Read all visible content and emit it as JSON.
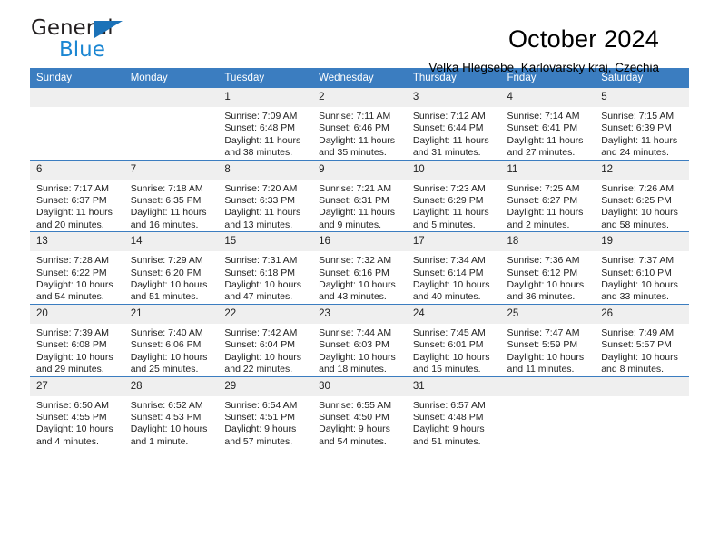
{
  "brand": {
    "name_part1": "General",
    "name_part2": "Blue",
    "triangle_icon": "triangle-icon",
    "accent_color": "#1b72b8",
    "blue_text_color": "#1b86d2"
  },
  "header": {
    "title": "October 2024",
    "subtitle": "Velka Hlegsebe, Karlovarsky kraj, Czechia"
  },
  "calendar": {
    "header_bg": "#3b7dc0",
    "daynum_bg": "#efefef",
    "weekday_headers": [
      "Sunday",
      "Monday",
      "Tuesday",
      "Wednesday",
      "Thursday",
      "Friday",
      "Saturday"
    ],
    "weeks": [
      [
        {
          "day": "",
          "sunrise": "",
          "sunset": "",
          "daylight1": "",
          "daylight2": ""
        },
        {
          "day": "",
          "sunrise": "",
          "sunset": "",
          "daylight1": "",
          "daylight2": ""
        },
        {
          "day": "1",
          "sunrise": "Sunrise: 7:09 AM",
          "sunset": "Sunset: 6:48 PM",
          "daylight1": "Daylight: 11 hours",
          "daylight2": "and 38 minutes."
        },
        {
          "day": "2",
          "sunrise": "Sunrise: 7:11 AM",
          "sunset": "Sunset: 6:46 PM",
          "daylight1": "Daylight: 11 hours",
          "daylight2": "and 35 minutes."
        },
        {
          "day": "3",
          "sunrise": "Sunrise: 7:12 AM",
          "sunset": "Sunset: 6:44 PM",
          "daylight1": "Daylight: 11 hours",
          "daylight2": "and 31 minutes."
        },
        {
          "day": "4",
          "sunrise": "Sunrise: 7:14 AM",
          "sunset": "Sunset: 6:41 PM",
          "daylight1": "Daylight: 11 hours",
          "daylight2": "and 27 minutes."
        },
        {
          "day": "5",
          "sunrise": "Sunrise: 7:15 AM",
          "sunset": "Sunset: 6:39 PM",
          "daylight1": "Daylight: 11 hours",
          "daylight2": "and 24 minutes."
        }
      ],
      [
        {
          "day": "6",
          "sunrise": "Sunrise: 7:17 AM",
          "sunset": "Sunset: 6:37 PM",
          "daylight1": "Daylight: 11 hours",
          "daylight2": "and 20 minutes."
        },
        {
          "day": "7",
          "sunrise": "Sunrise: 7:18 AM",
          "sunset": "Sunset: 6:35 PM",
          "daylight1": "Daylight: 11 hours",
          "daylight2": "and 16 minutes."
        },
        {
          "day": "8",
          "sunrise": "Sunrise: 7:20 AM",
          "sunset": "Sunset: 6:33 PM",
          "daylight1": "Daylight: 11 hours",
          "daylight2": "and 13 minutes."
        },
        {
          "day": "9",
          "sunrise": "Sunrise: 7:21 AM",
          "sunset": "Sunset: 6:31 PM",
          "daylight1": "Daylight: 11 hours",
          "daylight2": "and 9 minutes."
        },
        {
          "day": "10",
          "sunrise": "Sunrise: 7:23 AM",
          "sunset": "Sunset: 6:29 PM",
          "daylight1": "Daylight: 11 hours",
          "daylight2": "and 5 minutes."
        },
        {
          "day": "11",
          "sunrise": "Sunrise: 7:25 AM",
          "sunset": "Sunset: 6:27 PM",
          "daylight1": "Daylight: 11 hours",
          "daylight2": "and 2 minutes."
        },
        {
          "day": "12",
          "sunrise": "Sunrise: 7:26 AM",
          "sunset": "Sunset: 6:25 PM",
          "daylight1": "Daylight: 10 hours",
          "daylight2": "and 58 minutes."
        }
      ],
      [
        {
          "day": "13",
          "sunrise": "Sunrise: 7:28 AM",
          "sunset": "Sunset: 6:22 PM",
          "daylight1": "Daylight: 10 hours",
          "daylight2": "and 54 minutes."
        },
        {
          "day": "14",
          "sunrise": "Sunrise: 7:29 AM",
          "sunset": "Sunset: 6:20 PM",
          "daylight1": "Daylight: 10 hours",
          "daylight2": "and 51 minutes."
        },
        {
          "day": "15",
          "sunrise": "Sunrise: 7:31 AM",
          "sunset": "Sunset: 6:18 PM",
          "daylight1": "Daylight: 10 hours",
          "daylight2": "and 47 minutes."
        },
        {
          "day": "16",
          "sunrise": "Sunrise: 7:32 AM",
          "sunset": "Sunset: 6:16 PM",
          "daylight1": "Daylight: 10 hours",
          "daylight2": "and 43 minutes."
        },
        {
          "day": "17",
          "sunrise": "Sunrise: 7:34 AM",
          "sunset": "Sunset: 6:14 PM",
          "daylight1": "Daylight: 10 hours",
          "daylight2": "and 40 minutes."
        },
        {
          "day": "18",
          "sunrise": "Sunrise: 7:36 AM",
          "sunset": "Sunset: 6:12 PM",
          "daylight1": "Daylight: 10 hours",
          "daylight2": "and 36 minutes."
        },
        {
          "day": "19",
          "sunrise": "Sunrise: 7:37 AM",
          "sunset": "Sunset: 6:10 PM",
          "daylight1": "Daylight: 10 hours",
          "daylight2": "and 33 minutes."
        }
      ],
      [
        {
          "day": "20",
          "sunrise": "Sunrise: 7:39 AM",
          "sunset": "Sunset: 6:08 PM",
          "daylight1": "Daylight: 10 hours",
          "daylight2": "and 29 minutes."
        },
        {
          "day": "21",
          "sunrise": "Sunrise: 7:40 AM",
          "sunset": "Sunset: 6:06 PM",
          "daylight1": "Daylight: 10 hours",
          "daylight2": "and 25 minutes."
        },
        {
          "day": "22",
          "sunrise": "Sunrise: 7:42 AM",
          "sunset": "Sunset: 6:04 PM",
          "daylight1": "Daylight: 10 hours",
          "daylight2": "and 22 minutes."
        },
        {
          "day": "23",
          "sunrise": "Sunrise: 7:44 AM",
          "sunset": "Sunset: 6:03 PM",
          "daylight1": "Daylight: 10 hours",
          "daylight2": "and 18 minutes."
        },
        {
          "day": "24",
          "sunrise": "Sunrise: 7:45 AM",
          "sunset": "Sunset: 6:01 PM",
          "daylight1": "Daylight: 10 hours",
          "daylight2": "and 15 minutes."
        },
        {
          "day": "25",
          "sunrise": "Sunrise: 7:47 AM",
          "sunset": "Sunset: 5:59 PM",
          "daylight1": "Daylight: 10 hours",
          "daylight2": "and 11 minutes."
        },
        {
          "day": "26",
          "sunrise": "Sunrise: 7:49 AM",
          "sunset": "Sunset: 5:57 PM",
          "daylight1": "Daylight: 10 hours",
          "daylight2": "and 8 minutes."
        }
      ],
      [
        {
          "day": "27",
          "sunrise": "Sunrise: 6:50 AM",
          "sunset": "Sunset: 4:55 PM",
          "daylight1": "Daylight: 10 hours",
          "daylight2": "and 4 minutes."
        },
        {
          "day": "28",
          "sunrise": "Sunrise: 6:52 AM",
          "sunset": "Sunset: 4:53 PM",
          "daylight1": "Daylight: 10 hours",
          "daylight2": "and 1 minute."
        },
        {
          "day": "29",
          "sunrise": "Sunrise: 6:54 AM",
          "sunset": "Sunset: 4:51 PM",
          "daylight1": "Daylight: 9 hours",
          "daylight2": "and 57 minutes."
        },
        {
          "day": "30",
          "sunrise": "Sunrise: 6:55 AM",
          "sunset": "Sunset: 4:50 PM",
          "daylight1": "Daylight: 9 hours",
          "daylight2": "and 54 minutes."
        },
        {
          "day": "31",
          "sunrise": "Sunrise: 6:57 AM",
          "sunset": "Sunset: 4:48 PM",
          "daylight1": "Daylight: 9 hours",
          "daylight2": "and 51 minutes."
        },
        {
          "day": "",
          "sunrise": "",
          "sunset": "",
          "daylight1": "",
          "daylight2": ""
        },
        {
          "day": "",
          "sunrise": "",
          "sunset": "",
          "daylight1": "",
          "daylight2": ""
        }
      ]
    ]
  }
}
